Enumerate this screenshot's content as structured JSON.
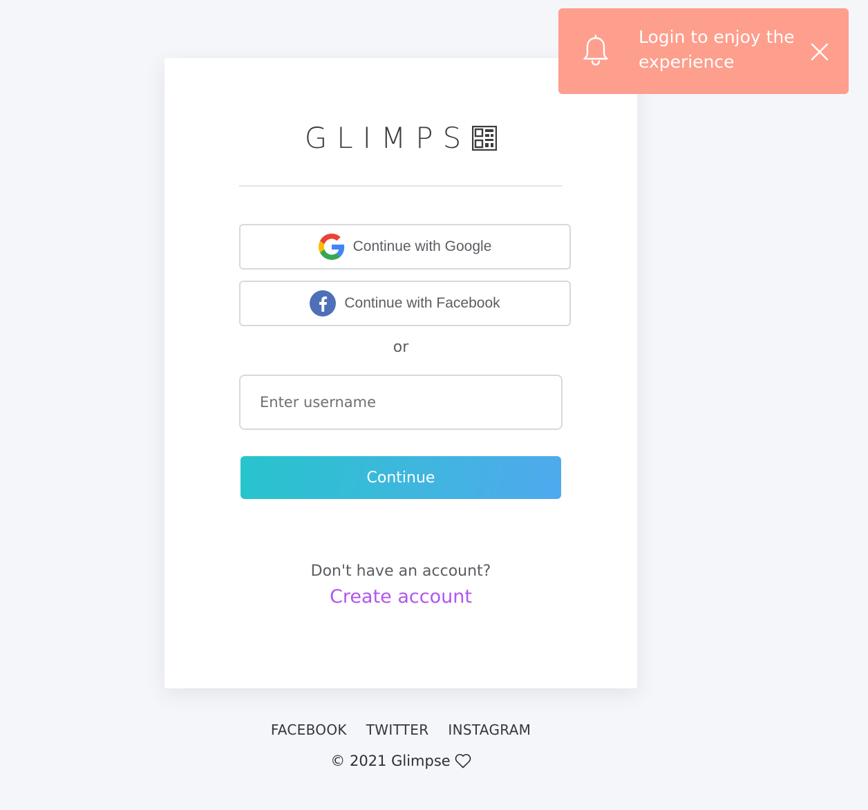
{
  "brand": {
    "logo_text": "GLIMPS"
  },
  "auth": {
    "google_label": "Continue with Google",
    "facebook_label": "Continue with Facebook",
    "or_label": "or",
    "username_placeholder": "Enter username",
    "username_value": "",
    "continue_label": "Continue",
    "no_account_text": "Don't have an account?",
    "create_account_label": "Create account"
  },
  "footer": {
    "links": [
      "FACEBOOK",
      "TWITTER",
      "INSTAGRAM"
    ],
    "copyright": "© 2021 Glimpse"
  },
  "toast": {
    "message": "Login to enjoy the experience"
  },
  "colors": {
    "page_bg": "#f4f6fa",
    "toast_bg": "#fe9e8c",
    "link_accent": "#b255ee",
    "button_gradient_start": "#26c4cc",
    "button_gradient_end": "#4fa9ee",
    "facebook_blue": "#4267b2"
  },
  "icons": {
    "google": "google-logo-icon",
    "facebook": "facebook-logo-icon",
    "toast": "bell-icon",
    "close": "close-icon",
    "copyright_suffix": "heart-icon",
    "brand_mark": "qr-code-icon"
  }
}
